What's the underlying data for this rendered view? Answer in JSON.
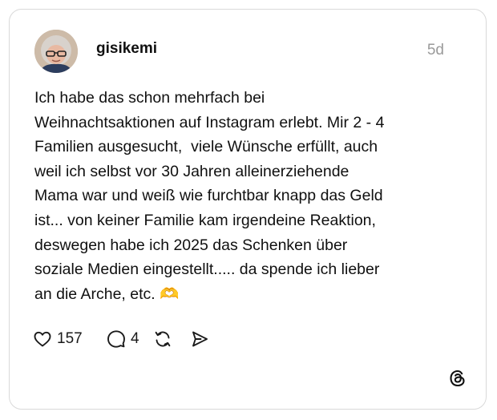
{
  "post": {
    "username": "gisikemi",
    "timestamp": "5d",
    "text": "Ich habe das schon mehrfach bei\nWeihnachtsaktionen auf Instagram erlebt. Mir 2 - 4\nFamilien ausgesucht,  viele Wünsche erfüllt, auch\nweil ich selbst vor 30 Jahren alleinerziehende\nMama war und weiß wie furchtbar knapp das Geld\nist... von keiner Familie kam irgendeine Reaktion,\ndeswegen habe ich 2025 das Schenken über\nsoziale Medien eingestellt..... da spende ich lieber\nan die Arche, etc. ",
    "emoji": "🫶"
  },
  "actions": {
    "like_count": "157",
    "reply_count": "4"
  },
  "icons": {
    "like": "heart-icon",
    "reply": "speech-bubble-icon",
    "repost": "repost-icon",
    "share": "send-icon",
    "brand": "threads-logo-icon"
  }
}
